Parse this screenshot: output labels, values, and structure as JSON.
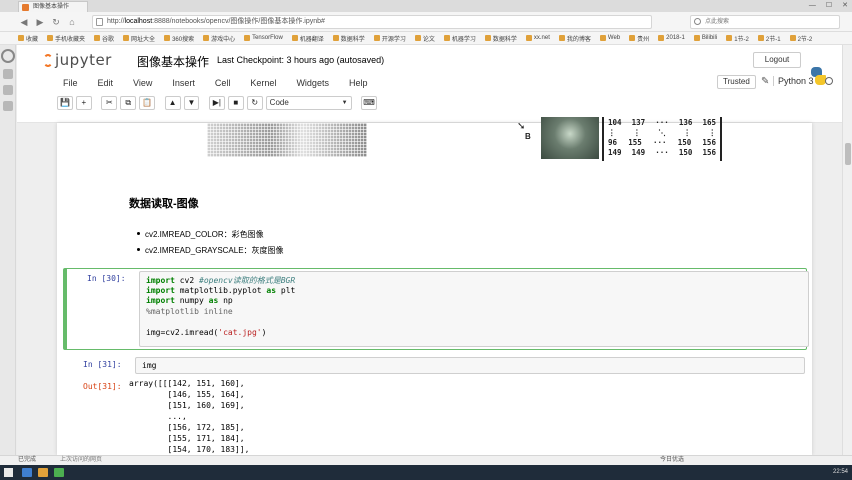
{
  "browser": {
    "tab_title": "图像基本操作",
    "url_host": "localhost",
    "url_rest": ":8888/notebooks/opencv/图像操作/图像基本操作.ipynb#",
    "url_prefix": "http://",
    "search_placeholder": "点此搜索",
    "bookmarks": [
      "收藏",
      "手机收藏夹",
      "谷歌",
      "网址大全",
      "360搜索",
      "游戏中心",
      "TensorFlow",
      "机器翻译",
      "数据科学",
      "开源学习",
      "论文",
      "机器学习",
      "数据科学",
      "xx.net",
      "我的博客",
      "Web",
      "贵州",
      "2018-1",
      "Bilibili",
      "1节-2",
      "2节-1",
      "2节-2"
    ]
  },
  "jupyter": {
    "logo_text": "jupyter",
    "notebook_name": "图像基本操作",
    "checkpoint": "Last Checkpoint: 3 hours ago (autosaved)",
    "logout_label": "Logout",
    "menu": [
      "File",
      "Edit",
      "View",
      "Insert",
      "Cell",
      "Kernel",
      "Widgets",
      "Help"
    ],
    "trusted_label": "Trusted",
    "kernel_name": "Python 3",
    "toolbar": {
      "save_icon": "💾",
      "insert_icon": "+",
      "cut_icon": "✂",
      "copy_icon": "⧉",
      "paste_icon": "📋",
      "move_up_icon": "▲",
      "move_down_icon": "▼",
      "run_icon": "▶|",
      "stop_icon": "■",
      "restart_icon": "↻",
      "cell_type": "Code",
      "keyboard_icon": "⌨"
    }
  },
  "notebook": {
    "figure_label": "B",
    "matrix": [
      [
        "104",
        "137",
        "···",
        "136",
        "165"
      ],
      [
        "⋮",
        "⋮",
        "⋱",
        "⋮",
        "⋮"
      ],
      [
        "96",
        "155",
        "···",
        "150",
        "156"
      ],
      [
        "149",
        "149",
        "···",
        "150",
        "156"
      ]
    ],
    "md_heading": "数据读取-图像",
    "md_bullets": [
      "cv2.IMREAD_COLOR：彩色图像",
      "cv2.IMREAD_GRAYSCALE：灰度图像"
    ],
    "cell30_prompt": "In [30]:",
    "cell30_lines": [
      {
        "kw": "import",
        "rest": " cv2 ",
        "cm": "#opencv读取的格式是BGR"
      },
      {
        "kw": "import",
        "rest": " matplotlib.pyplot ",
        "kw2": "as",
        "rest2": " plt"
      },
      {
        "kw": "import",
        "rest": " numpy ",
        "kw2": "as",
        "rest2": " np"
      },
      {
        "mag": "%matplotlib inline"
      },
      {
        "blank": true
      },
      {
        "code": "img=cv2.imread(",
        "str": "'cat.jpg'",
        "end": ")"
      }
    ],
    "cell31_prompt": "In [31]:",
    "cell31_code": "img",
    "out31_prompt": "Out[31]:",
    "out31_lines": [
      "array([[[142, 151, 160],",
      "        [146, 155, 164],",
      "        [151, 160, 169],",
      "        ...,",
      "        [156, 172, 185],",
      "        [155, 171, 184],",
      "        [154, 170, 183]],"
    ]
  },
  "status": {
    "left": "已完成",
    "middle": "上次访问的网页",
    "right": "今日优选"
  },
  "taskbar": {
    "clock": "22:54"
  }
}
